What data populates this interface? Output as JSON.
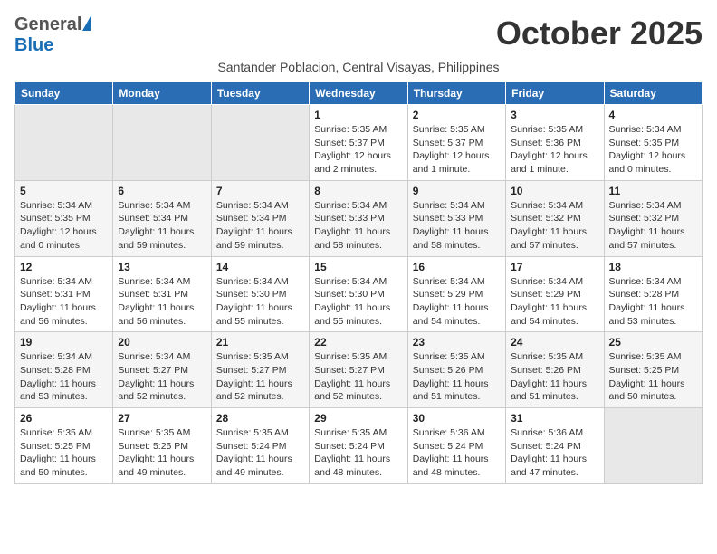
{
  "header": {
    "logo_general": "General",
    "logo_blue": "Blue",
    "month": "October 2025",
    "subtitle": "Santander Poblacion, Central Visayas, Philippines"
  },
  "weekdays": [
    "Sunday",
    "Monday",
    "Tuesday",
    "Wednesday",
    "Thursday",
    "Friday",
    "Saturday"
  ],
  "rows": [
    {
      "alt": false,
      "cells": [
        {
          "day": "",
          "info": ""
        },
        {
          "day": "",
          "info": ""
        },
        {
          "day": "",
          "info": ""
        },
        {
          "day": "1",
          "info": "Sunrise: 5:35 AM\nSunset: 5:37 PM\nDaylight: 12 hours\nand 2 minutes."
        },
        {
          "day": "2",
          "info": "Sunrise: 5:35 AM\nSunset: 5:37 PM\nDaylight: 12 hours\nand 1 minute."
        },
        {
          "day": "3",
          "info": "Sunrise: 5:35 AM\nSunset: 5:36 PM\nDaylight: 12 hours\nand 1 minute."
        },
        {
          "day": "4",
          "info": "Sunrise: 5:34 AM\nSunset: 5:35 PM\nDaylight: 12 hours\nand 0 minutes."
        }
      ]
    },
    {
      "alt": true,
      "cells": [
        {
          "day": "5",
          "info": "Sunrise: 5:34 AM\nSunset: 5:35 PM\nDaylight: 12 hours\nand 0 minutes."
        },
        {
          "day": "6",
          "info": "Sunrise: 5:34 AM\nSunset: 5:34 PM\nDaylight: 11 hours\nand 59 minutes."
        },
        {
          "day": "7",
          "info": "Sunrise: 5:34 AM\nSunset: 5:34 PM\nDaylight: 11 hours\nand 59 minutes."
        },
        {
          "day": "8",
          "info": "Sunrise: 5:34 AM\nSunset: 5:33 PM\nDaylight: 11 hours\nand 58 minutes."
        },
        {
          "day": "9",
          "info": "Sunrise: 5:34 AM\nSunset: 5:33 PM\nDaylight: 11 hours\nand 58 minutes."
        },
        {
          "day": "10",
          "info": "Sunrise: 5:34 AM\nSunset: 5:32 PM\nDaylight: 11 hours\nand 57 minutes."
        },
        {
          "day": "11",
          "info": "Sunrise: 5:34 AM\nSunset: 5:32 PM\nDaylight: 11 hours\nand 57 minutes."
        }
      ]
    },
    {
      "alt": false,
      "cells": [
        {
          "day": "12",
          "info": "Sunrise: 5:34 AM\nSunset: 5:31 PM\nDaylight: 11 hours\nand 56 minutes."
        },
        {
          "day": "13",
          "info": "Sunrise: 5:34 AM\nSunset: 5:31 PM\nDaylight: 11 hours\nand 56 minutes."
        },
        {
          "day": "14",
          "info": "Sunrise: 5:34 AM\nSunset: 5:30 PM\nDaylight: 11 hours\nand 55 minutes."
        },
        {
          "day": "15",
          "info": "Sunrise: 5:34 AM\nSunset: 5:30 PM\nDaylight: 11 hours\nand 55 minutes."
        },
        {
          "day": "16",
          "info": "Sunrise: 5:34 AM\nSunset: 5:29 PM\nDaylight: 11 hours\nand 54 minutes."
        },
        {
          "day": "17",
          "info": "Sunrise: 5:34 AM\nSunset: 5:29 PM\nDaylight: 11 hours\nand 54 minutes."
        },
        {
          "day": "18",
          "info": "Sunrise: 5:34 AM\nSunset: 5:28 PM\nDaylight: 11 hours\nand 53 minutes."
        }
      ]
    },
    {
      "alt": true,
      "cells": [
        {
          "day": "19",
          "info": "Sunrise: 5:34 AM\nSunset: 5:28 PM\nDaylight: 11 hours\nand 53 minutes."
        },
        {
          "day": "20",
          "info": "Sunrise: 5:34 AM\nSunset: 5:27 PM\nDaylight: 11 hours\nand 52 minutes."
        },
        {
          "day": "21",
          "info": "Sunrise: 5:35 AM\nSunset: 5:27 PM\nDaylight: 11 hours\nand 52 minutes."
        },
        {
          "day": "22",
          "info": "Sunrise: 5:35 AM\nSunset: 5:27 PM\nDaylight: 11 hours\nand 52 minutes."
        },
        {
          "day": "23",
          "info": "Sunrise: 5:35 AM\nSunset: 5:26 PM\nDaylight: 11 hours\nand 51 minutes."
        },
        {
          "day": "24",
          "info": "Sunrise: 5:35 AM\nSunset: 5:26 PM\nDaylight: 11 hours\nand 51 minutes."
        },
        {
          "day": "25",
          "info": "Sunrise: 5:35 AM\nSunset: 5:25 PM\nDaylight: 11 hours\nand 50 minutes."
        }
      ]
    },
    {
      "alt": false,
      "cells": [
        {
          "day": "26",
          "info": "Sunrise: 5:35 AM\nSunset: 5:25 PM\nDaylight: 11 hours\nand 50 minutes."
        },
        {
          "day": "27",
          "info": "Sunrise: 5:35 AM\nSunset: 5:25 PM\nDaylight: 11 hours\nand 49 minutes."
        },
        {
          "day": "28",
          "info": "Sunrise: 5:35 AM\nSunset: 5:24 PM\nDaylight: 11 hours\nand 49 minutes."
        },
        {
          "day": "29",
          "info": "Sunrise: 5:35 AM\nSunset: 5:24 PM\nDaylight: 11 hours\nand 48 minutes."
        },
        {
          "day": "30",
          "info": "Sunrise: 5:36 AM\nSunset: 5:24 PM\nDaylight: 11 hours\nand 48 minutes."
        },
        {
          "day": "31",
          "info": "Sunrise: 5:36 AM\nSunset: 5:24 PM\nDaylight: 11 hours\nand 47 minutes."
        },
        {
          "day": "",
          "info": ""
        }
      ]
    }
  ]
}
